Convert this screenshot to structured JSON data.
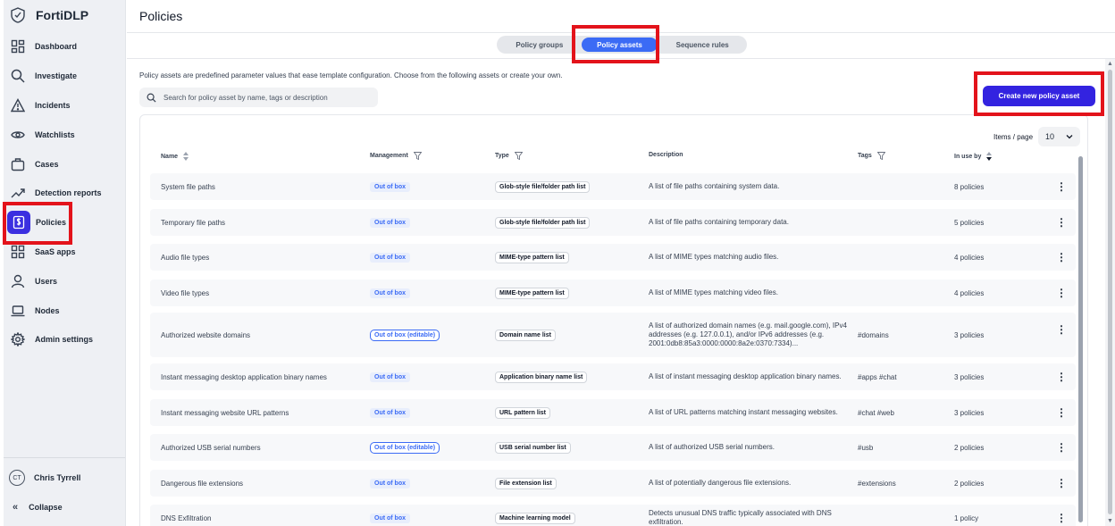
{
  "app": {
    "name": "FortiDLP"
  },
  "sidebar": {
    "items": [
      {
        "label": "Dashboard",
        "icon": "dashboard-icon"
      },
      {
        "label": "Investigate",
        "icon": "search-icon"
      },
      {
        "label": "Incidents",
        "icon": "warning-icon"
      },
      {
        "label": "Watchlists",
        "icon": "eye-icon"
      },
      {
        "label": "Cases",
        "icon": "briefcase-icon"
      },
      {
        "label": "Detection reports",
        "icon": "trend-icon"
      },
      {
        "label": "Policies",
        "icon": "policy-icon",
        "active": true
      },
      {
        "label": "SaaS apps",
        "icon": "apps-icon"
      },
      {
        "label": "Users",
        "icon": "user-icon"
      },
      {
        "label": "Nodes",
        "icon": "laptop-icon"
      },
      {
        "label": "Admin settings",
        "icon": "gear-icon"
      }
    ],
    "user": {
      "initials": "CT",
      "name": "Chris Tyrrell"
    },
    "collapse_label": "Collapse"
  },
  "main": {
    "title": "Policies",
    "tabs": [
      {
        "label": "Policy groups"
      },
      {
        "label": "Policy assets",
        "active": true
      },
      {
        "label": "Sequence rules"
      }
    ],
    "description": "Policy assets are predefined parameter values that ease template configuration. Choose from the following assets or create your own.",
    "search": {
      "placeholder": "Search for policy asset by name, tags or description"
    },
    "create_button": "Create new policy asset",
    "items_per_page": {
      "label": "Items / page",
      "value": "10"
    },
    "table": {
      "headers": {
        "name": "Name",
        "management": "Management",
        "type": "Type",
        "description": "Description",
        "tags": "Tags",
        "in_use_by": "In use by"
      },
      "rows": [
        {
          "name": "System file paths",
          "management": "Out of box",
          "type": "Glob-style file/folder path list",
          "description": "A list of file paths containing system data.",
          "tags": "",
          "in_use_by": "8 policies"
        },
        {
          "name": "Temporary file paths",
          "management": "Out of box",
          "type": "Glob-style file/folder path list",
          "description": "A list of file paths containing temporary data.",
          "tags": "",
          "in_use_by": "5 policies"
        },
        {
          "name": "Audio file types",
          "management": "Out of box",
          "type": "MIME-type pattern list",
          "description": "A list of MIME types matching audio files.",
          "tags": "",
          "in_use_by": "4 policies"
        },
        {
          "name": "Video file types",
          "management": "Out of box",
          "type": "MIME-type pattern list",
          "description": "A list of MIME types matching video files.",
          "tags": "",
          "in_use_by": "4 policies"
        },
        {
          "name": "Authorized website domains",
          "management": "Out of box (editable)",
          "type": "Domain name list",
          "description": "A list of authorized domain names (e.g. mail.google.com), IPv4 addresses (e.g. 127.0.0.1), and/or IPv6 addresses (e.g. 2001:0db8:85a3:0000:0000:8a2e:0370:7334)...",
          "tags": "#domains",
          "in_use_by": "3 policies"
        },
        {
          "name": "Instant messaging desktop application binary names",
          "management": "Out of box",
          "type": "Application binary name list",
          "description": "A list of instant messaging desktop application binary names.",
          "tags": "#apps #chat",
          "in_use_by": "3 policies"
        },
        {
          "name": "Instant messaging website URL patterns",
          "management": "Out of box",
          "type": "URL pattern list",
          "description": "A list of URL patterns matching instant messaging websites.",
          "tags": "#chat #web",
          "in_use_by": "3 policies"
        },
        {
          "name": "Authorized USB serial numbers",
          "management": "Out of box (editable)",
          "type": "USB serial number list",
          "description": "A list of authorized USB serial numbers.",
          "tags": "#usb",
          "in_use_by": "2 policies"
        },
        {
          "name": "Dangerous file extensions",
          "management": "Out of box",
          "type": "File extension list",
          "description": "A list of potentially dangerous file extensions.",
          "tags": "#extensions",
          "in_use_by": "2 policies"
        },
        {
          "name": "DNS Exfiltration",
          "management": "Out of box",
          "type": "Machine learning model",
          "description": "Detects unusual DNS traffic typically associated with DNS exfiltration.",
          "tags": "",
          "in_use_by": "1 policy"
        }
      ]
    }
  },
  "colors": {
    "accent": "#3323e0",
    "tab_active": "#3b6bf5",
    "highlight": "#e3131b"
  }
}
